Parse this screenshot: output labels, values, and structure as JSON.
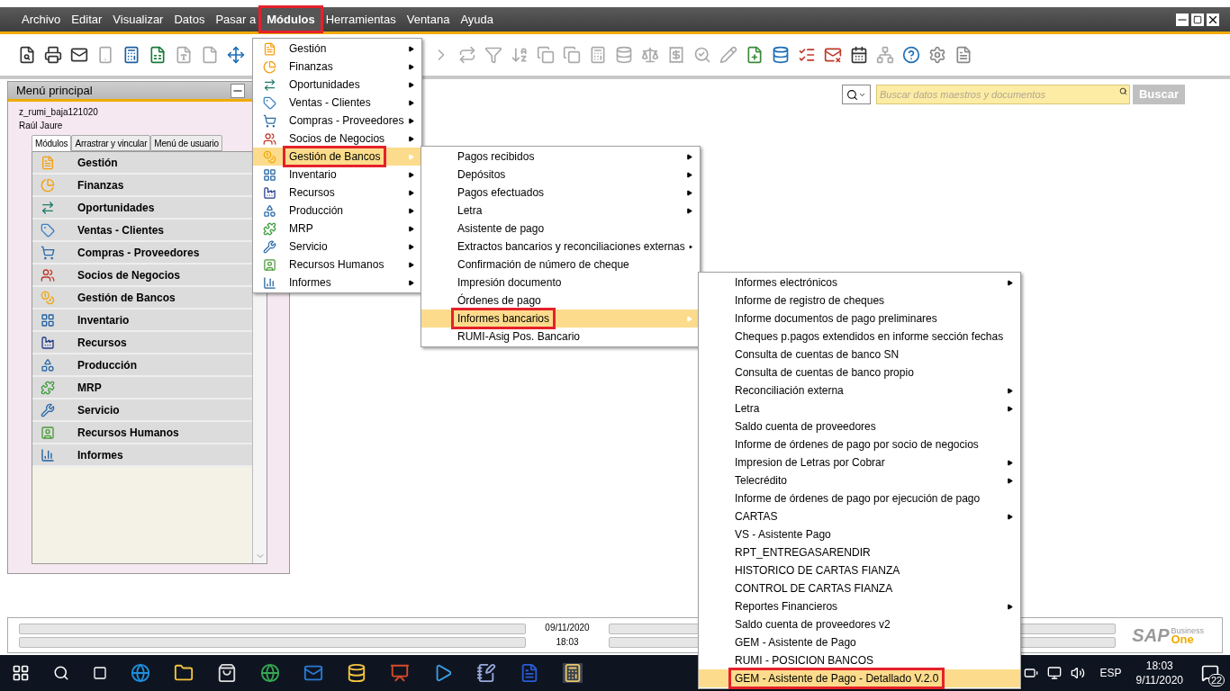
{
  "menubar": [
    {
      "label": "Archivo",
      "selected": false,
      "highlighted": false
    },
    {
      "label": "Editar",
      "selected": false,
      "highlighted": false
    },
    {
      "label": "Visualizar",
      "selected": false,
      "highlighted": false
    },
    {
      "label": "Datos",
      "selected": false,
      "highlighted": false
    },
    {
      "label": "Pasar a",
      "selected": false,
      "highlighted": false
    },
    {
      "label": "Módulos",
      "selected": true,
      "highlighted": true
    },
    {
      "label": "Herramientas",
      "selected": false,
      "highlighted": false
    },
    {
      "label": "Ventana",
      "selected": false,
      "highlighted": false
    },
    {
      "label": "Ayuda",
      "selected": false,
      "highlighted": false
    }
  ],
  "search": {
    "placeholder": "Buscar datos maestros y documentos",
    "button": "Buscar"
  },
  "main_menu": {
    "title": "Menú principal",
    "company": "z_rumi_baja121020",
    "user": "Raúl Jaure",
    "tabs": [
      {
        "label": "Módulos",
        "selected": true
      },
      {
        "label": "Arrastrar y vincular",
        "selected": false
      },
      {
        "label": "Menú de usuario",
        "selected": false
      }
    ],
    "modules": [
      "Gestión",
      "Finanzas",
      "Oportunidades",
      "Ventas - Clientes",
      "Compras - Proveedores",
      "Socios de Negocios",
      "Gestión de Bancos",
      "Inventario",
      "Recursos",
      "Producción",
      "MRP",
      "Servicio",
      "Recursos Humanos",
      "Informes"
    ]
  },
  "modules_menu": [
    {
      "label": "Gestión",
      "submenu": true,
      "selected": false,
      "highlighted": false
    },
    {
      "label": "Finanzas",
      "submenu": true,
      "selected": false,
      "highlighted": false
    },
    {
      "label": "Oportunidades",
      "submenu": true,
      "selected": false,
      "highlighted": false
    },
    {
      "label": "Ventas - Clientes",
      "submenu": true,
      "selected": false,
      "highlighted": false
    },
    {
      "label": "Compras - Proveedores",
      "submenu": true,
      "selected": false,
      "highlighted": false
    },
    {
      "label": "Socios de Negocios",
      "submenu": true,
      "selected": false,
      "highlighted": false
    },
    {
      "label": "Gestión de Bancos",
      "submenu": true,
      "selected": true,
      "highlighted": true
    },
    {
      "label": "Inventario",
      "submenu": true,
      "selected": false,
      "highlighted": false
    },
    {
      "label": "Recursos",
      "submenu": true,
      "selected": false,
      "highlighted": false
    },
    {
      "label": "Producción",
      "submenu": true,
      "selected": false,
      "highlighted": false
    },
    {
      "label": "MRP",
      "submenu": true,
      "selected": false,
      "highlighted": false
    },
    {
      "label": "Servicio",
      "submenu": true,
      "selected": false,
      "highlighted": false
    },
    {
      "label": "Recursos Humanos",
      "submenu": true,
      "selected": false,
      "highlighted": false
    },
    {
      "label": "Informes",
      "submenu": true,
      "selected": false,
      "highlighted": false
    }
  ],
  "banks_menu": [
    {
      "label": "Pagos recibidos",
      "submenu": true,
      "selected": false,
      "highlighted": false
    },
    {
      "label": "Depósitos",
      "submenu": true,
      "selected": false,
      "highlighted": false
    },
    {
      "label": "Pagos efectuados",
      "submenu": true,
      "selected": false,
      "highlighted": false
    },
    {
      "label": "Letra",
      "submenu": true,
      "selected": false,
      "highlighted": false
    },
    {
      "label": "Asistente de pago",
      "submenu": false,
      "selected": false,
      "highlighted": false
    },
    {
      "label": "Extractos bancarios y reconciliaciones externas",
      "submenu": true,
      "selected": false,
      "highlighted": false
    },
    {
      "label": "Confirmación de número de cheque",
      "submenu": false,
      "selected": false,
      "highlighted": false
    },
    {
      "label": "Impresión documento",
      "submenu": false,
      "selected": false,
      "highlighted": false
    },
    {
      "label": "Órdenes de pago",
      "submenu": false,
      "selected": false,
      "highlighted": false
    },
    {
      "label": "Informes bancarios",
      "submenu": true,
      "selected": true,
      "highlighted": true
    },
    {
      "label": "RUMI-Asig Pos. Bancario",
      "submenu": false,
      "selected": false,
      "highlighted": false
    }
  ],
  "reports_menu": [
    {
      "label": "Informes electrónicos",
      "submenu": true,
      "selected": false,
      "highlighted": false
    },
    {
      "label": "Informe de registro de cheques",
      "submenu": false,
      "selected": false,
      "highlighted": false
    },
    {
      "label": "Informe documentos de pago preliminares",
      "submenu": false,
      "selected": false,
      "highlighted": false
    },
    {
      "label": "Cheques p.pagos extendidos en informe sección fechas",
      "submenu": false,
      "selected": false,
      "highlighted": false
    },
    {
      "label": "Consulta de cuentas de banco SN",
      "submenu": false,
      "selected": false,
      "highlighted": false
    },
    {
      "label": "Consulta de cuentas de banco propio",
      "submenu": false,
      "selected": false,
      "highlighted": false
    },
    {
      "label": "Reconciliación externa",
      "submenu": true,
      "selected": false,
      "highlighted": false
    },
    {
      "label": "Letra",
      "submenu": true,
      "selected": false,
      "highlighted": false
    },
    {
      "label": "Saldo cuenta de proveedores",
      "submenu": false,
      "selected": false,
      "highlighted": false
    },
    {
      "label": "Informe de órdenes de pago por socio de negocios",
      "submenu": false,
      "selected": false,
      "highlighted": false
    },
    {
      "label": "Impresion de Letras por Cobrar",
      "submenu": true,
      "selected": false,
      "highlighted": false
    },
    {
      "label": "Telecrédito",
      "submenu": true,
      "selected": false,
      "highlighted": false
    },
    {
      "label": "Informe de órdenes de pago por ejecución de pago",
      "submenu": false,
      "selected": false,
      "highlighted": false
    },
    {
      "label": "CARTAS",
      "submenu": true,
      "selected": false,
      "highlighted": false
    },
    {
      "label": "VS - Asistente Pago",
      "submenu": false,
      "selected": false,
      "highlighted": false
    },
    {
      "label": "RPT_ENTREGASARENDIR",
      "submenu": false,
      "selected": false,
      "highlighted": false
    },
    {
      "label": "HISTORICO DE CARTAS FIANZA",
      "submenu": false,
      "selected": false,
      "highlighted": false
    },
    {
      "label": "CONTROL DE CARTAS FIANZA",
      "submenu": false,
      "selected": false,
      "highlighted": false
    },
    {
      "label": "Reportes Financieros",
      "submenu": true,
      "selected": false,
      "highlighted": false
    },
    {
      "label": "Saldo cuenta de proveedores v2",
      "submenu": false,
      "selected": false,
      "highlighted": false
    },
    {
      "label": "GEM - Asistente de Pago",
      "submenu": false,
      "selected": false,
      "highlighted": false
    },
    {
      "label": "RUMI - POSICION BANCOS",
      "submenu": false,
      "selected": false,
      "highlighted": false
    },
    {
      "label": "GEM - Asistente de Pago - Detallado V.2.0",
      "submenu": false,
      "selected": true,
      "highlighted": true
    }
  ],
  "status_bar": {
    "date": "09/11/2020",
    "time": "18:03"
  },
  "logo": {
    "name": "SAP",
    "line1": "Business",
    "line2": "One"
  },
  "taskbar": {
    "language": "ESP",
    "time": "18:03",
    "date": "9/11/2020",
    "notifications": "22"
  }
}
